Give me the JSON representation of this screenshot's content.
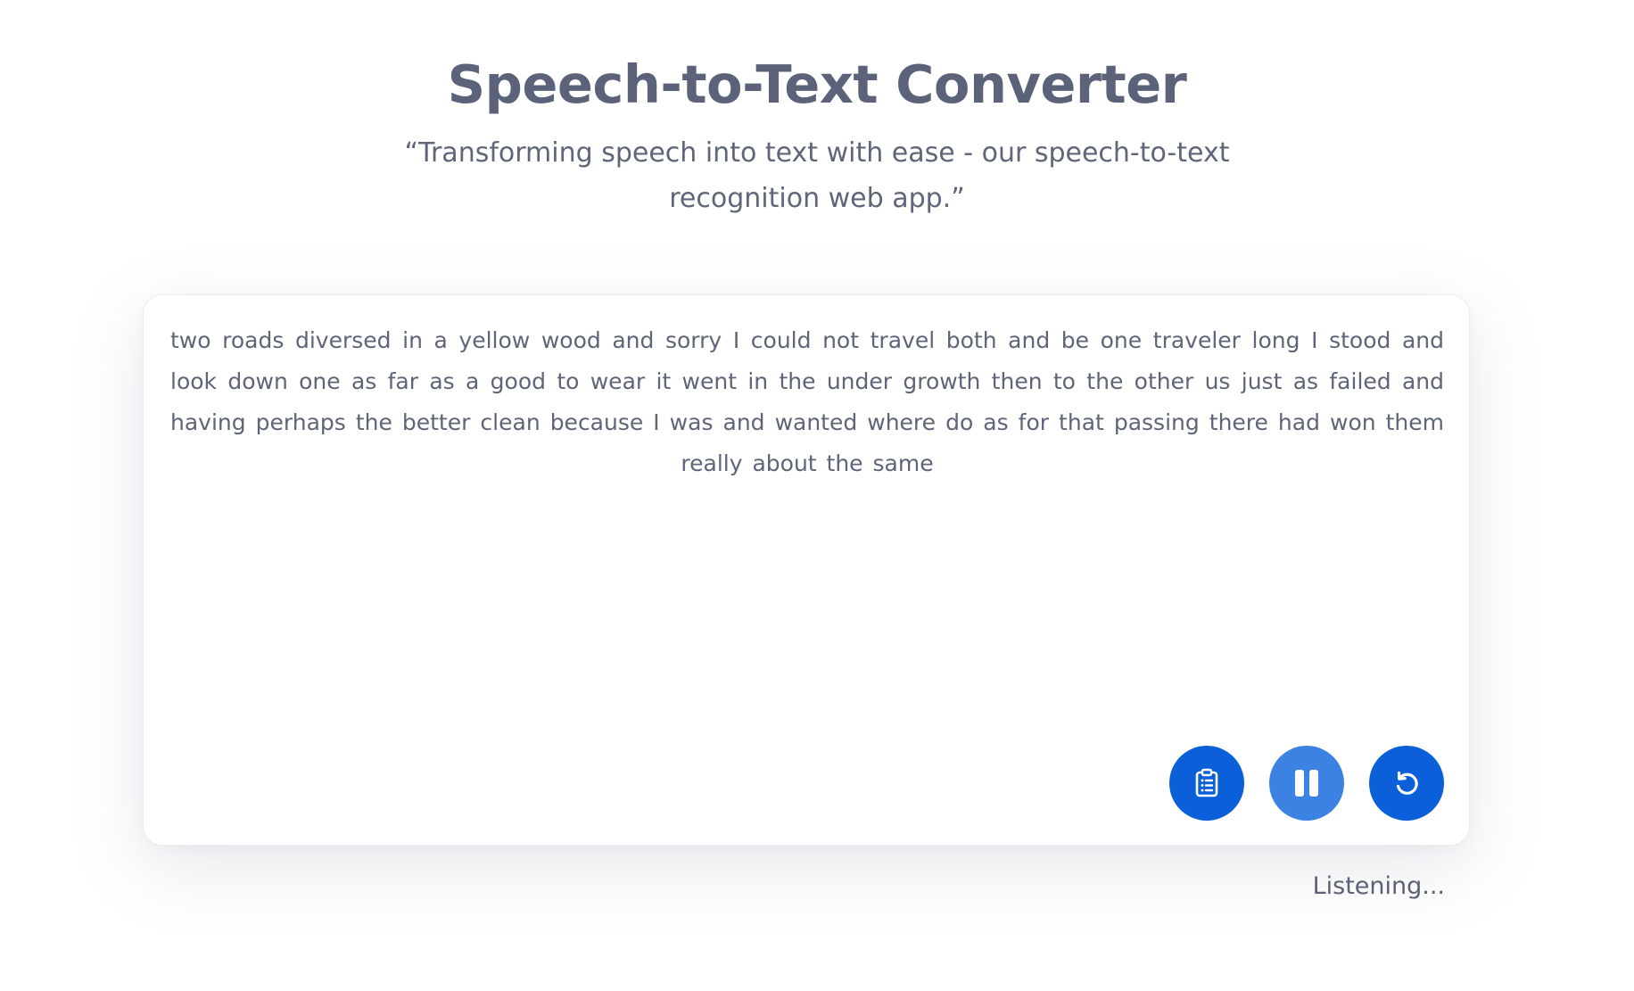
{
  "header": {
    "title": "Speech-to-Text Converter",
    "subtitle": "“Transforming speech into text with ease - our speech-to-text recognition web app.”"
  },
  "transcript": {
    "text": "two roads diversed in a yellow wood and sorry I could not travel both and be one traveler long I stood and look down one as far as a good to wear it went in the under growth then to the other us just as failed and having perhaps the better clean because I was and wanted where do as for that passing there had won them really about the same"
  },
  "controls": {
    "copy_icon": "clipboard-icon",
    "pause_icon": "pause-icon",
    "reset_icon": "reset-icon",
    "primary_color": "#0b5fd9",
    "active_color": "#3c82e3"
  },
  "status": {
    "text": "Listening..."
  }
}
